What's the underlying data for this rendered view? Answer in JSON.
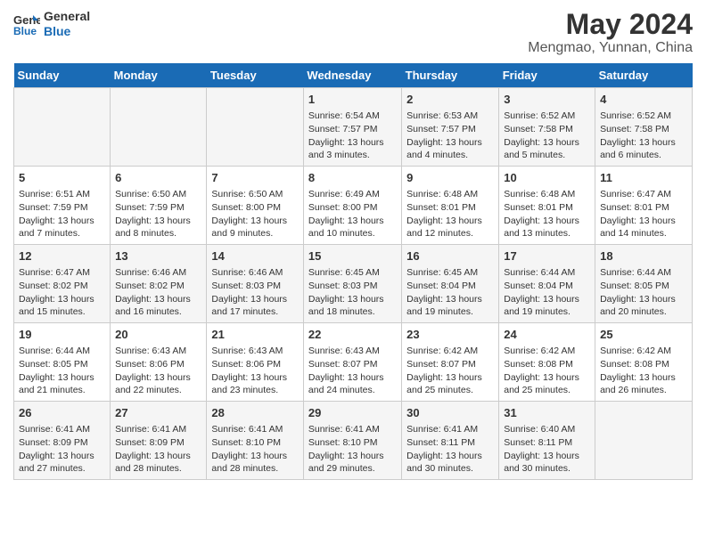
{
  "header": {
    "logo_line1": "General",
    "logo_line2": "Blue",
    "month_title": "May 2024",
    "subtitle": "Mengmao, Yunnan, China"
  },
  "weekdays": [
    "Sunday",
    "Monday",
    "Tuesday",
    "Wednesday",
    "Thursday",
    "Friday",
    "Saturday"
  ],
  "weeks": [
    [
      {
        "day": "",
        "info": ""
      },
      {
        "day": "",
        "info": ""
      },
      {
        "day": "",
        "info": ""
      },
      {
        "day": "1",
        "info": "Sunrise: 6:54 AM\nSunset: 7:57 PM\nDaylight: 13 hours and 3 minutes."
      },
      {
        "day": "2",
        "info": "Sunrise: 6:53 AM\nSunset: 7:57 PM\nDaylight: 13 hours and 4 minutes."
      },
      {
        "day": "3",
        "info": "Sunrise: 6:52 AM\nSunset: 7:58 PM\nDaylight: 13 hours and 5 minutes."
      },
      {
        "day": "4",
        "info": "Sunrise: 6:52 AM\nSunset: 7:58 PM\nDaylight: 13 hours and 6 minutes."
      }
    ],
    [
      {
        "day": "5",
        "info": "Sunrise: 6:51 AM\nSunset: 7:59 PM\nDaylight: 13 hours and 7 minutes."
      },
      {
        "day": "6",
        "info": "Sunrise: 6:50 AM\nSunset: 7:59 PM\nDaylight: 13 hours and 8 minutes."
      },
      {
        "day": "7",
        "info": "Sunrise: 6:50 AM\nSunset: 8:00 PM\nDaylight: 13 hours and 9 minutes."
      },
      {
        "day": "8",
        "info": "Sunrise: 6:49 AM\nSunset: 8:00 PM\nDaylight: 13 hours and 10 minutes."
      },
      {
        "day": "9",
        "info": "Sunrise: 6:48 AM\nSunset: 8:01 PM\nDaylight: 13 hours and 12 minutes."
      },
      {
        "day": "10",
        "info": "Sunrise: 6:48 AM\nSunset: 8:01 PM\nDaylight: 13 hours and 13 minutes."
      },
      {
        "day": "11",
        "info": "Sunrise: 6:47 AM\nSunset: 8:01 PM\nDaylight: 13 hours and 14 minutes."
      }
    ],
    [
      {
        "day": "12",
        "info": "Sunrise: 6:47 AM\nSunset: 8:02 PM\nDaylight: 13 hours and 15 minutes."
      },
      {
        "day": "13",
        "info": "Sunrise: 6:46 AM\nSunset: 8:02 PM\nDaylight: 13 hours and 16 minutes."
      },
      {
        "day": "14",
        "info": "Sunrise: 6:46 AM\nSunset: 8:03 PM\nDaylight: 13 hours and 17 minutes."
      },
      {
        "day": "15",
        "info": "Sunrise: 6:45 AM\nSunset: 8:03 PM\nDaylight: 13 hours and 18 minutes."
      },
      {
        "day": "16",
        "info": "Sunrise: 6:45 AM\nSunset: 8:04 PM\nDaylight: 13 hours and 19 minutes."
      },
      {
        "day": "17",
        "info": "Sunrise: 6:44 AM\nSunset: 8:04 PM\nDaylight: 13 hours and 19 minutes."
      },
      {
        "day": "18",
        "info": "Sunrise: 6:44 AM\nSunset: 8:05 PM\nDaylight: 13 hours and 20 minutes."
      }
    ],
    [
      {
        "day": "19",
        "info": "Sunrise: 6:44 AM\nSunset: 8:05 PM\nDaylight: 13 hours and 21 minutes."
      },
      {
        "day": "20",
        "info": "Sunrise: 6:43 AM\nSunset: 8:06 PM\nDaylight: 13 hours and 22 minutes."
      },
      {
        "day": "21",
        "info": "Sunrise: 6:43 AM\nSunset: 8:06 PM\nDaylight: 13 hours and 23 minutes."
      },
      {
        "day": "22",
        "info": "Sunrise: 6:43 AM\nSunset: 8:07 PM\nDaylight: 13 hours and 24 minutes."
      },
      {
        "day": "23",
        "info": "Sunrise: 6:42 AM\nSunset: 8:07 PM\nDaylight: 13 hours and 25 minutes."
      },
      {
        "day": "24",
        "info": "Sunrise: 6:42 AM\nSunset: 8:08 PM\nDaylight: 13 hours and 25 minutes."
      },
      {
        "day": "25",
        "info": "Sunrise: 6:42 AM\nSunset: 8:08 PM\nDaylight: 13 hours and 26 minutes."
      }
    ],
    [
      {
        "day": "26",
        "info": "Sunrise: 6:41 AM\nSunset: 8:09 PM\nDaylight: 13 hours and 27 minutes."
      },
      {
        "day": "27",
        "info": "Sunrise: 6:41 AM\nSunset: 8:09 PM\nDaylight: 13 hours and 28 minutes."
      },
      {
        "day": "28",
        "info": "Sunrise: 6:41 AM\nSunset: 8:10 PM\nDaylight: 13 hours and 28 minutes."
      },
      {
        "day": "29",
        "info": "Sunrise: 6:41 AM\nSunset: 8:10 PM\nDaylight: 13 hours and 29 minutes."
      },
      {
        "day": "30",
        "info": "Sunrise: 6:41 AM\nSunset: 8:11 PM\nDaylight: 13 hours and 30 minutes."
      },
      {
        "day": "31",
        "info": "Sunrise: 6:40 AM\nSunset: 8:11 PM\nDaylight: 13 hours and 30 minutes."
      },
      {
        "day": "",
        "info": ""
      }
    ]
  ]
}
